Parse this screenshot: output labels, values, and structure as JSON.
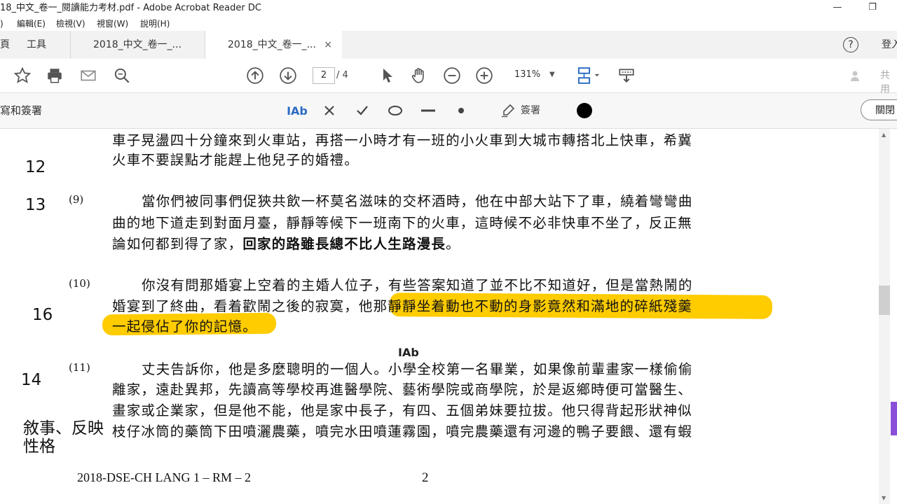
{
  "window": {
    "title": "18_中文_卷一_閱讀能力考材.pdf - Adobe Acrobat Reader DC",
    "minimize": "—",
    "restore": "❐"
  },
  "menu": {
    "item0": ")",
    "edit": "編輯(E)",
    "view": "檢視(V)",
    "window": "視窗(W)",
    "help": "說明(H)"
  },
  "tabs": {
    "home": "頁",
    "tools": "工具",
    "doc1": "2018_中文_卷一_...",
    "doc2": "2018_中文_卷一_...",
    "close": "×",
    "help_icon": "?",
    "signin": "登入"
  },
  "toolbar": {
    "page_current": "2",
    "page_total": "/ 4",
    "zoom": "131%",
    "share": "共用"
  },
  "fill_sign": {
    "label": "寫和簽署",
    "text_tool": "IAb",
    "sign": "簽署",
    "close": "關閉"
  },
  "document": {
    "p8_line1": "車子晃盪四十分鐘來到火車站，再搭一小時才有一班的小火車到大城市轉搭北上快車，希冀",
    "p8_line2": "火車不要誤點才能趕上他兒子的婚禮。",
    "p9_num": "(9)",
    "p9_line1": "當你們被同事們促狹共飲一杯莫名滋味的交杯酒時，他在中部大站下了車，繞着彎彎曲",
    "p9_line2": "曲的地下道走到對面月臺，靜靜等候下一班南下的火車，這時候不必非快車不坐了，反正無",
    "p9_line3a": "論如何都到得了家，",
    "p9_line3b": "回家的路雖長總不比人生路漫長",
    "p9_line3c": "。",
    "p10_num": "(10)",
    "p10_line1": "你沒有問那婚宴上空着的主婚人位子，有些答案知道了並不比不知道好，但是當熱鬧的",
    "p10_line2a": "婚宴到了終曲，看着歡鬧之後的寂寞，",
    "p10_line2b": "他那靜靜坐着動也不動的身影竟然和滿地的碎紙殘羹",
    "p10_line3": "一起侵佔了你的記憶。",
    "cursor_text": "IAb",
    "p11_num": "(11)",
    "p11_line1": "丈夫告訴你，他是多麼聰明的一個人。小學全校第一名畢業，如果像前輩畫家一樣偷偷",
    "p11_line2": "離家，遠赴異邦，先讀高等學校再進醫學院、藝術學院或商學院，於是返鄉時便可當醫生、",
    "p11_line3": "畫家或企業家，但是他不能，他是家中長子，有四、五個弟妹要拉拔。他只得背起形狀神似",
    "p11_line4": "枝仔冰筒的藥筒下田噴灑農藥，噴完水田噴蓮霧園，噴完農藥還有河邊的鴨子要餵、還有蝦",
    "footer_left": "2018-DSE-CH LANG 1 – RM – 2",
    "footer_page": "2"
  },
  "annotations": {
    "n12": "12",
    "n13": "13",
    "n16": "16",
    "n14": "14",
    "note1": "敘事、反映",
    "note2": "性格"
  },
  "colors": {
    "highlight": "#ffcc00",
    "accent": "#2b6cc4",
    "purple": "#8a4fd8"
  }
}
